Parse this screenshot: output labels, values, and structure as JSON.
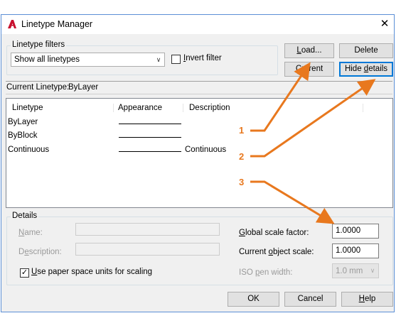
{
  "window": {
    "title": "Linetype Manager",
    "close_glyph": "✕",
    "app_icon": "autocad-logo-icon"
  },
  "filters": {
    "group_label": "Linetype filters",
    "selected": "Show all linetypes",
    "invert_label": "Invert filter",
    "invert_checked": false
  },
  "buttons": {
    "load": "Load...",
    "delete": "Delete",
    "current": "Current",
    "hide_details": "Hide details",
    "ok": "OK",
    "cancel": "Cancel",
    "help": "Help"
  },
  "current_linetype": {
    "label": "Current Linetype:",
    "value": "ByLayer"
  },
  "table": {
    "columns": [
      "Linetype",
      "Appearance",
      "Description"
    ],
    "rows": [
      {
        "name": "ByLayer",
        "description": ""
      },
      {
        "name": "ByBlock",
        "description": ""
      },
      {
        "name": "Continuous",
        "description": "Continuous"
      }
    ]
  },
  "details": {
    "group_label": "Details",
    "name_label": "Name:",
    "name_value": "",
    "description_label": "Description:",
    "description_value": "",
    "paper_space_label": "Use paper space units for scaling",
    "paper_space_checked": true,
    "global_scale_label": "Global scale factor:",
    "global_scale_value": "1.0000",
    "object_scale_label": "Current object scale:",
    "object_scale_value": "1.0000",
    "iso_pen_label": "ISO pen width:",
    "iso_pen_value": "1.0 mm"
  },
  "callouts": [
    "1",
    "2",
    "3"
  ],
  "colors": {
    "accent": "#0078d7",
    "callout": "#e8781e",
    "title_icon": "#c8102e"
  }
}
